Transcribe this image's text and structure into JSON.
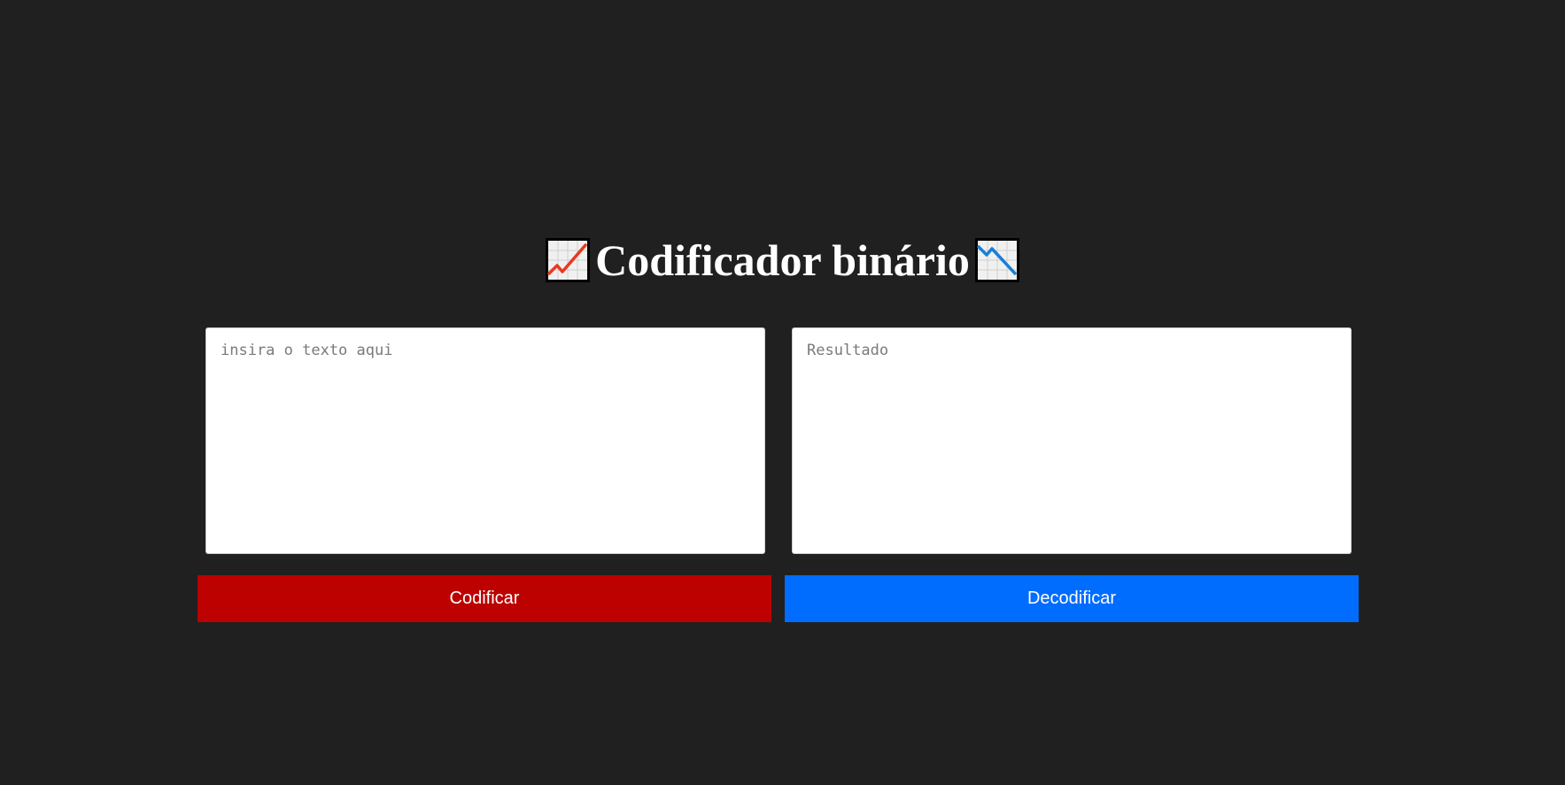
{
  "header": {
    "title": "Codificador binário",
    "left_icon": "chart-increasing-icon",
    "right_icon": "chart-decreasing-icon"
  },
  "input": {
    "placeholder": "insira o texto aqui",
    "value": ""
  },
  "output": {
    "placeholder": "Resultado",
    "value": ""
  },
  "buttons": {
    "encode_label": "Codificar",
    "decode_label": "Decodificar"
  },
  "colors": {
    "background": "#202020",
    "encode_button": "#bd0000",
    "decode_button": "#006dff",
    "title": "#ffffff"
  }
}
